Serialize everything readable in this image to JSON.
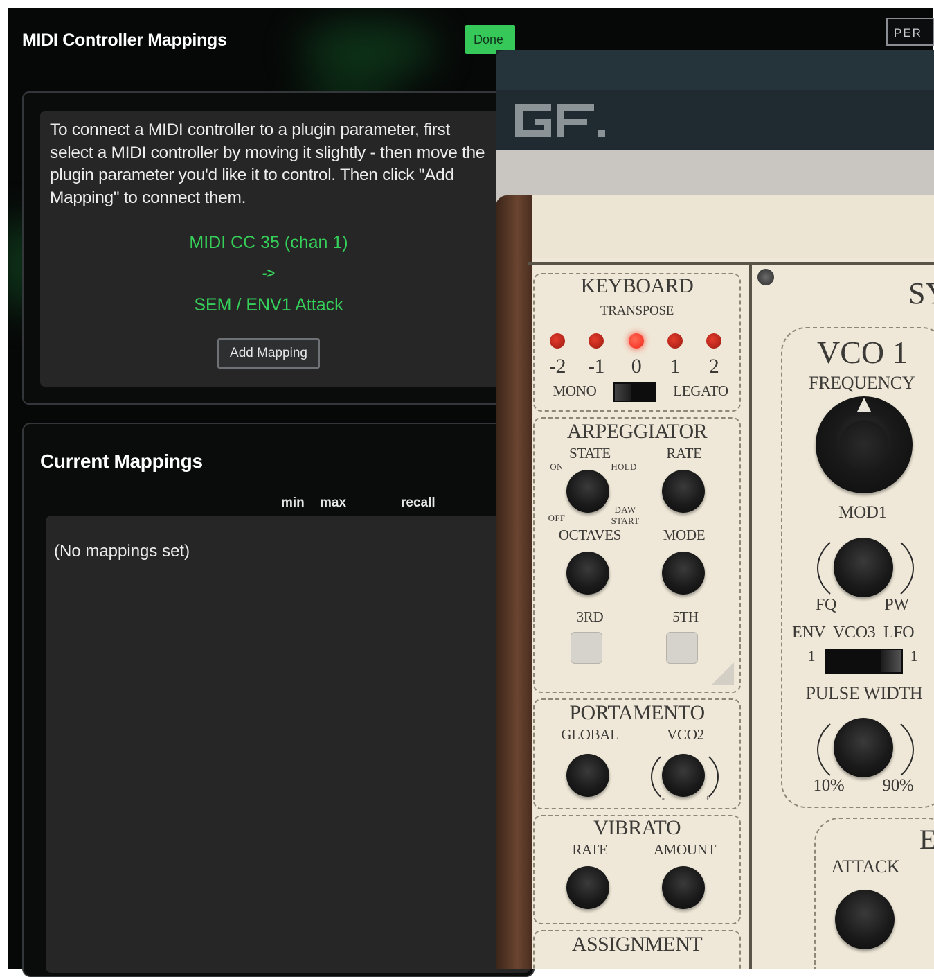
{
  "dialog": {
    "title": "MIDI Controller Mappings",
    "done_label": "Done",
    "perf_label": "PER",
    "instructions": "To connect a MIDI controller to a plugin parameter, first select a MIDI controller by moving it slightly - then move the plugin parameter you'd like it to control. Then click \"Add Mapping\" to connect them.",
    "selected_controller": "MIDI CC 35 (chan 1)",
    "arrow": "->",
    "selected_parameter": "SEM / ENV1 Attack",
    "add_mapping_label": "Add Mapping",
    "current_mappings_title": "Current Mappings",
    "columns": {
      "min": "min",
      "max": "max",
      "recall": "recall"
    },
    "empty_text": "(No mappings set)",
    "accent_color": "#35cf5a"
  },
  "plugin": {
    "logo": "GF.",
    "keyboard": {
      "title": "KEYBOARD",
      "transpose_label": "TRANSPOSE",
      "transpose_values": [
        "-2",
        "-1",
        "0",
        "1",
        "2"
      ],
      "transpose_selected": "0",
      "mono_label": "MONO",
      "legato_label": "LEGATO"
    },
    "arpeggiator": {
      "title": "ARPEGGIATOR",
      "state_label": "STATE",
      "rate_label": "RATE",
      "on_label": "ON",
      "hold_label": "HOLD",
      "off_label": "OFF",
      "daw_start_label_1": "DAW",
      "daw_start_label_2": "START",
      "octaves_label": "OCTAVES",
      "mode_label": "MODE",
      "third_label": "3RD",
      "fifth_label": "5TH"
    },
    "portamento": {
      "title": "PORTAMENTO",
      "global_label": "GLOBAL",
      "vco2_label": "VCO2",
      "minus": "-",
      "plus": "+"
    },
    "vibrato": {
      "title": "VIBRATO",
      "rate_label": "RATE",
      "amount_label": "AMOUNT"
    },
    "assignment": {
      "title": "ASSIGNMENT"
    },
    "synth_title_partial": "SY",
    "vco1": {
      "title": "VCO 1",
      "frequency_label": "FREQUENCY",
      "mod1_label": "MOD1",
      "fq_label": "FQ",
      "pw_label": "PW",
      "source_labels": "ENV  VCO3  LFO",
      "env_num": "1",
      "lfo_num": "1",
      "pulse_width_label": "PULSE WIDTH",
      "pw_min": "10%",
      "pw_max": "90%"
    },
    "env": {
      "title_partial": "E",
      "attack_label": "ATTACK"
    }
  }
}
